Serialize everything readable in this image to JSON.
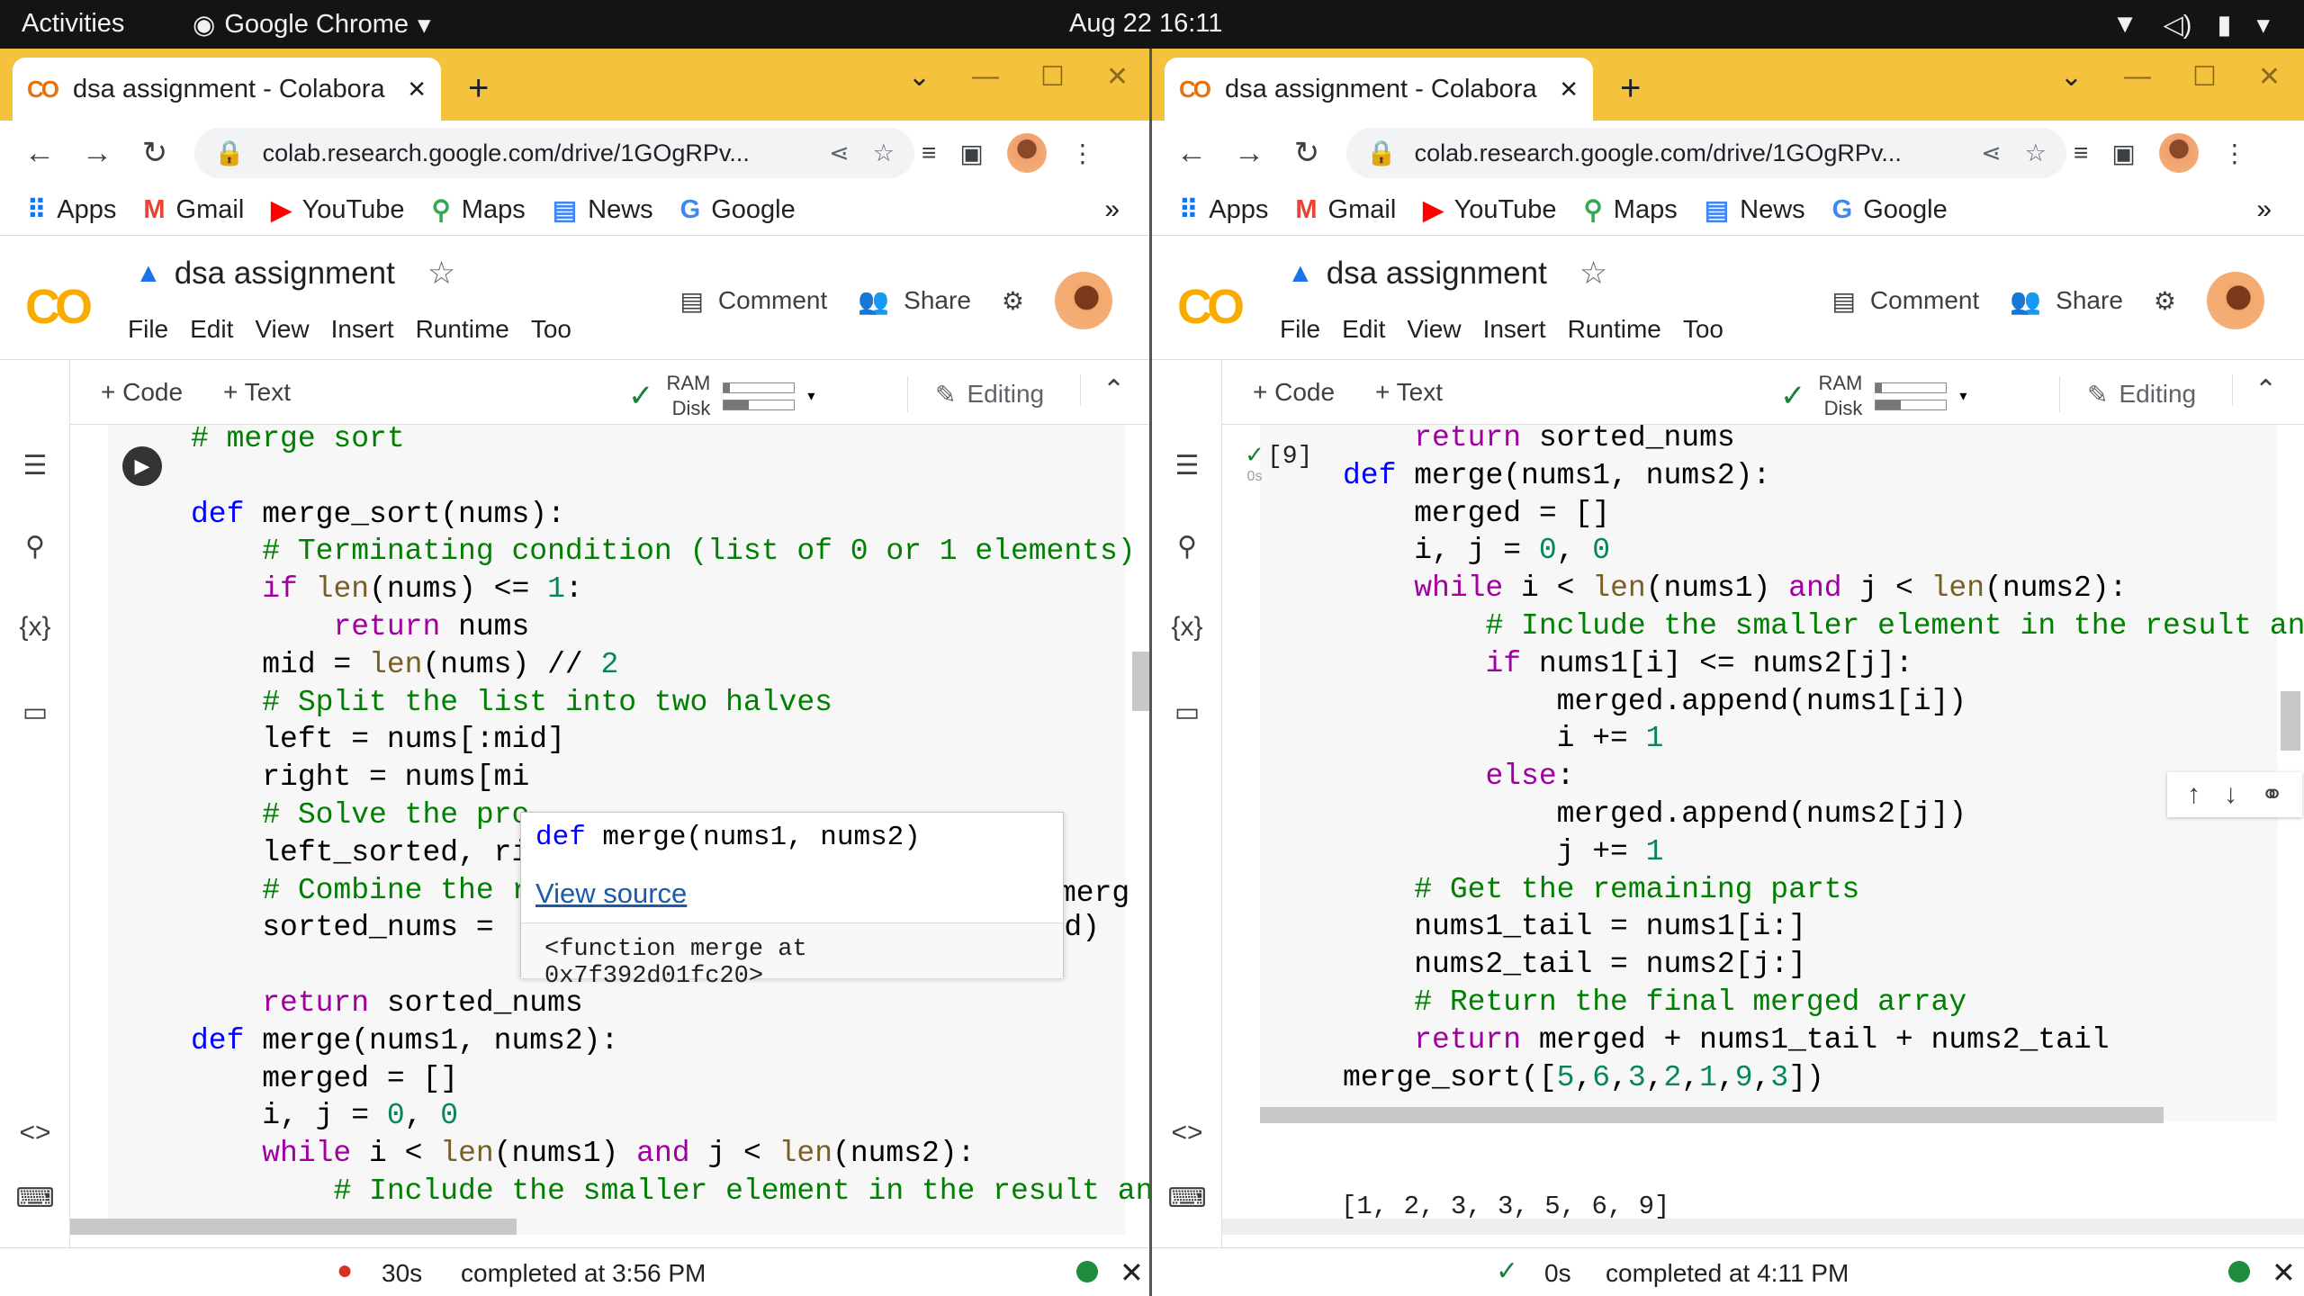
{
  "system_bar": {
    "activities": "Activities",
    "app_name": "Google Chrome",
    "clock": "Aug 22  16:11"
  },
  "browser": {
    "tab_title": "dsa assignment - Colabora",
    "url": "colab.research.google.com/drive/1GOgRPv...",
    "bookmarks": [
      "Apps",
      "Gmail",
      "YouTube",
      "Maps",
      "News",
      "Google"
    ],
    "bookmark_more": "»"
  },
  "colab": {
    "logo": "CO",
    "notebook_title": "dsa assignment",
    "menu": [
      "File",
      "Edit",
      "View",
      "Insert",
      "Runtime",
      "Too"
    ],
    "comment": "Comment",
    "share": "Share",
    "add_code": "+ Code",
    "add_text": "+ Text",
    "ram_label": "RAM",
    "disk_label": "Disk",
    "ram_usage": 0.08,
    "disk_usage": 0.35,
    "editing": "Editing"
  },
  "left_pane": {
    "code_lines": [
      "# merge sort",
      "",
      "def merge_sort(nums):",
      "    # Terminating condition (list of 0 or 1 elements)",
      "    if len(nums) <= 1:",
      "        return nums",
      "    mid = len(nums) // 2",
      "    # Split the list into two halves",
      "    left = nums[:mid]",
      "    right = nums[mi",
      "    # Solve the pro",
      "    left_sorted, ri",
      "    # Combine the r",
      "    sorted_nums =  merge(left_sorted, right_sorted)",
      "",
      "    return sorted_nums",
      "def merge(nums1, nums2):",
      "    merged = []",
      "    i, j = 0, 0",
      "    while i < len(nums1) and j < len(nums2):",
      "        # Include the smaller element in the result an"
    ],
    "clipped_fragment": "merg",
    "tooltip": {
      "keyword": "def",
      "signature": " merge(nums1, nums2)",
      "view_source": "View source",
      "repr": "<function merge at 0x7f392d01fc20>"
    },
    "status_time": "30s",
    "status_msg": "completed at 3:56 PM"
  },
  "right_pane": {
    "exec_time": "0s",
    "exec_count": "[9]",
    "code_lines": [
      "    return sorted_nums",
      "def merge(nums1, nums2):",
      "    merged = []",
      "    i, j = 0, 0",
      "    while i < len(nums1) and j < len(nums2):",
      "        # Include the smaller element in the result an",
      "        if nums1[i] <= nums2[j]:",
      "            merged.append(nums1[i])",
      "            i += 1",
      "        else:",
      "            merged.append(nums2[j])",
      "            j += 1",
      "    # Get the remaining parts",
      "    nums1_tail = nums1[i:]",
      "    nums2_tail = nums2[j:]",
      "    # Return the final merged array",
      "    return merged + nums1_tail + nums2_tail",
      "merge_sort([5,6,3,2,1,9,3])"
    ],
    "output": "[1, 2, 3, 3, 5, 6, 9]",
    "status_time": "0s",
    "status_msg": "completed at 4:11 PM"
  },
  "colors": {
    "tabstrip": "#f5c23d",
    "keyword": "#0000ff",
    "control_keyword": "#a000a0",
    "comment": "#008000",
    "number": "#098658",
    "builtin": "#795e26"
  }
}
